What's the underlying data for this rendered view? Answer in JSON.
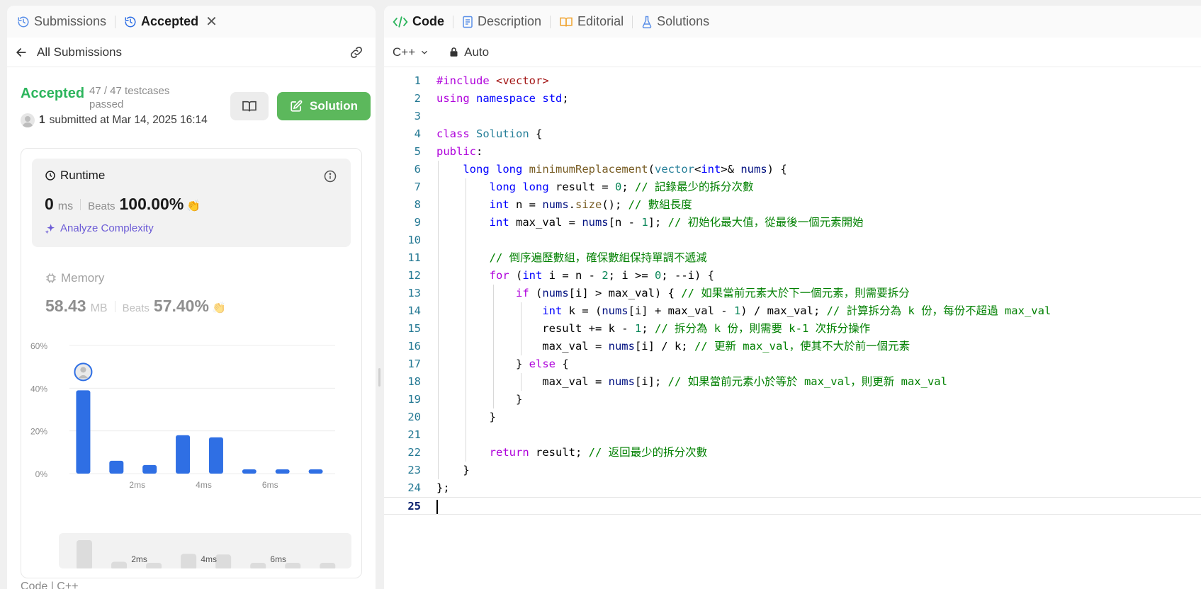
{
  "left_panel": {
    "tabs": [
      {
        "label": "Submissions",
        "icon": "history-icon"
      },
      {
        "label": "Accepted",
        "icon": "history-icon"
      }
    ],
    "back_label": "All Submissions",
    "status": "Accepted",
    "testcases": "47 / 47 testcases passed",
    "submitter_name": "1",
    "submitted_at": "submitted at Mar 14, 2025 16:14",
    "solution_button": "Solution",
    "runtime": {
      "title": "Runtime",
      "value": "0",
      "unit": "ms",
      "beats_label": "Beats",
      "beats_value": "100.00%",
      "analyze_label": "Analyze Complexity"
    },
    "memory": {
      "title": "Memory",
      "value": "58.43",
      "unit": "MB",
      "beats_label": "Beats",
      "beats_value": "57.40%"
    },
    "footer_partial": "Code  |  C++"
  },
  "chart_data": {
    "type": "bar",
    "title": "",
    "xlabel": "",
    "ylabel": "",
    "ylim": [
      0,
      60
    ],
    "yticks": [
      "60%",
      "40%",
      "20%",
      "0%"
    ],
    "xtick_labels": [
      "2ms",
      "4ms",
      "6ms"
    ],
    "values": [
      39,
      6,
      4,
      18,
      17,
      2,
      2,
      2
    ],
    "highlight_index": 0,
    "grid": true
  },
  "mini_chart": {
    "values": [
      39,
      6,
      4,
      18,
      17,
      2,
      2,
      2
    ],
    "xtick_labels": [
      "2ms",
      "4ms",
      "6ms"
    ]
  },
  "right_panel": {
    "tabs": [
      {
        "label": "Code",
        "icon": "code-icon"
      },
      {
        "label": "Description",
        "icon": "document-icon"
      },
      {
        "label": "Editorial",
        "icon": "book-icon"
      },
      {
        "label": "Solutions",
        "icon": "flask-icon"
      }
    ],
    "language": "C++",
    "mode": "Auto",
    "line_numbers": [
      "1",
      "2",
      "3",
      "4",
      "5",
      "6",
      "7",
      "8",
      "9",
      "10",
      "11",
      "12",
      "13",
      "14",
      "15",
      "16",
      "17",
      "18",
      "19",
      "20",
      "21",
      "22",
      "23",
      "24",
      "25"
    ],
    "code_lines": [
      "#include <vector>",
      "using namespace std;",
      "",
      "class Solution {",
      "public:",
      "    long long minimumReplacement(vector<int>& nums) {",
      "        long long result = 0; // 記錄最少的拆分次數",
      "        int n = nums.size(); // 數組長度",
      "        int max_val = nums[n - 1]; // 初始化最大值，從最後一個元素開始",
      "",
      "        // 倒序遍歷數組，確保數組保持單調不遞減",
      "        for (int i = n - 2; i >= 0; --i) {",
      "            if (nums[i] > max_val) { // 如果當前元素大於下一個元素，則需要拆分",
      "                int k = (nums[i] + max_val - 1) / max_val; // 計算拆分為 k 份，每份不超過 max_val",
      "                result += k - 1; // 拆分為 k 份，則需要 k-1 次拆分操作",
      "                max_val = nums[i] / k; // 更新 max_val，使其不大於前一個元素",
      "            } else {",
      "                max_val = nums[i]; // 如果當前元素小於等於 max_val，則更新 max_val",
      "            }",
      "        }",
      "",
      "        return result; // 返回最少的拆分次數",
      "    }",
      "};",
      ""
    ]
  },
  "colors": {
    "accepted_green": "#2db55d",
    "solution_button": "#5cb85c",
    "bar_blue": "#2f6fe4",
    "analyze_purple": "#6b5bd6"
  }
}
